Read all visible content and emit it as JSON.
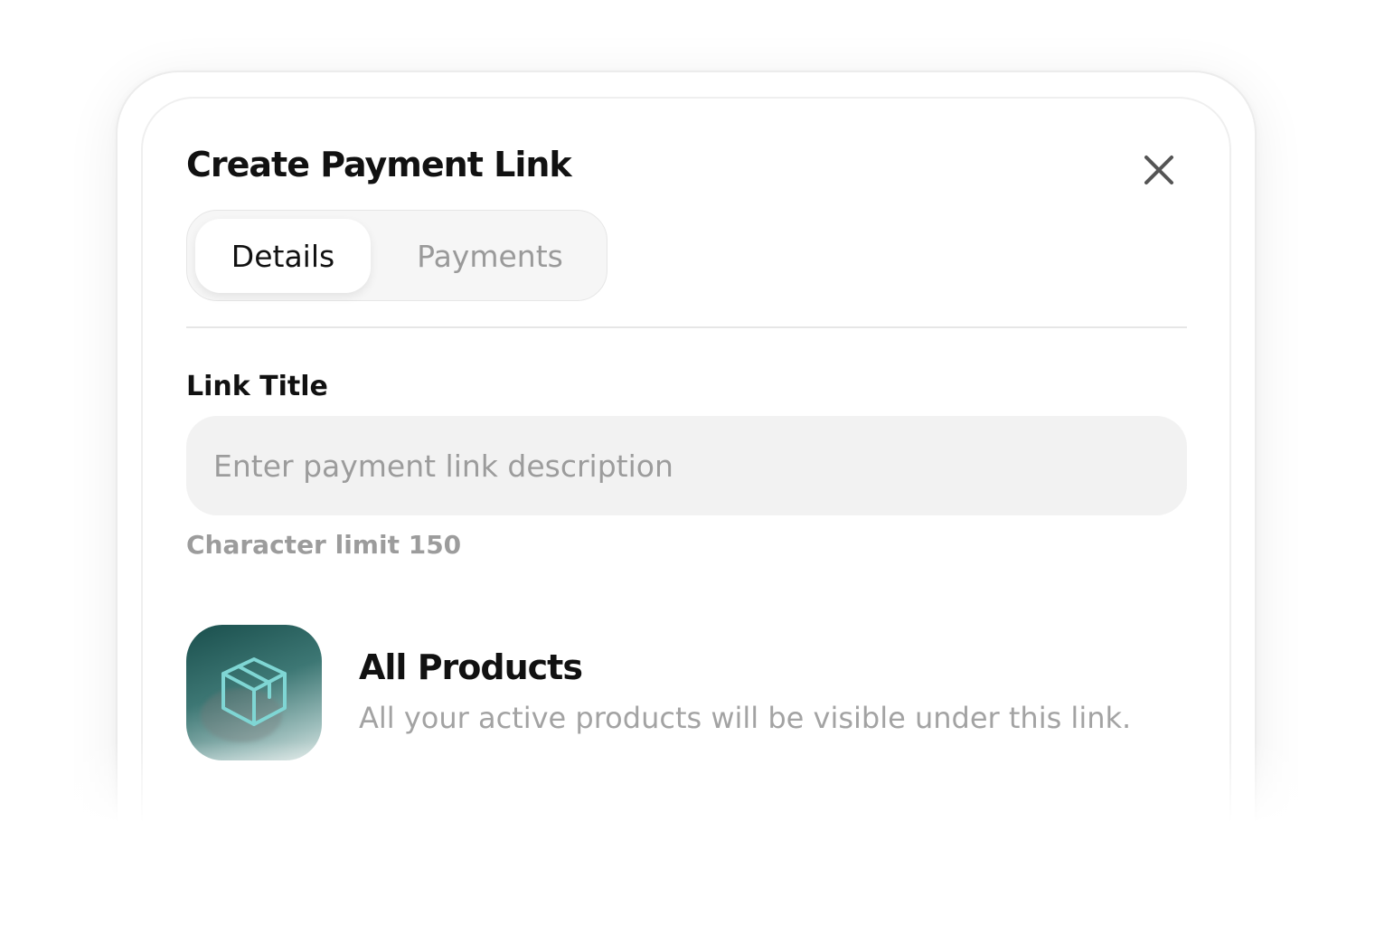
{
  "modal": {
    "title": "Create Payment Link",
    "close_icon": "close-icon"
  },
  "tabs": [
    {
      "label": "Details",
      "active": true
    },
    {
      "label": "Payments",
      "active": false
    }
  ],
  "link_title": {
    "label": "Link Title",
    "value": "",
    "placeholder": "Enter payment link description",
    "hint": "Character limit 150"
  },
  "option": {
    "icon": "box-icon",
    "title": "All Products",
    "description": "All your active products will be visible under this link."
  },
  "colors": {
    "accent": "#1a4f4d",
    "icon_stroke": "#7fd6d4"
  }
}
